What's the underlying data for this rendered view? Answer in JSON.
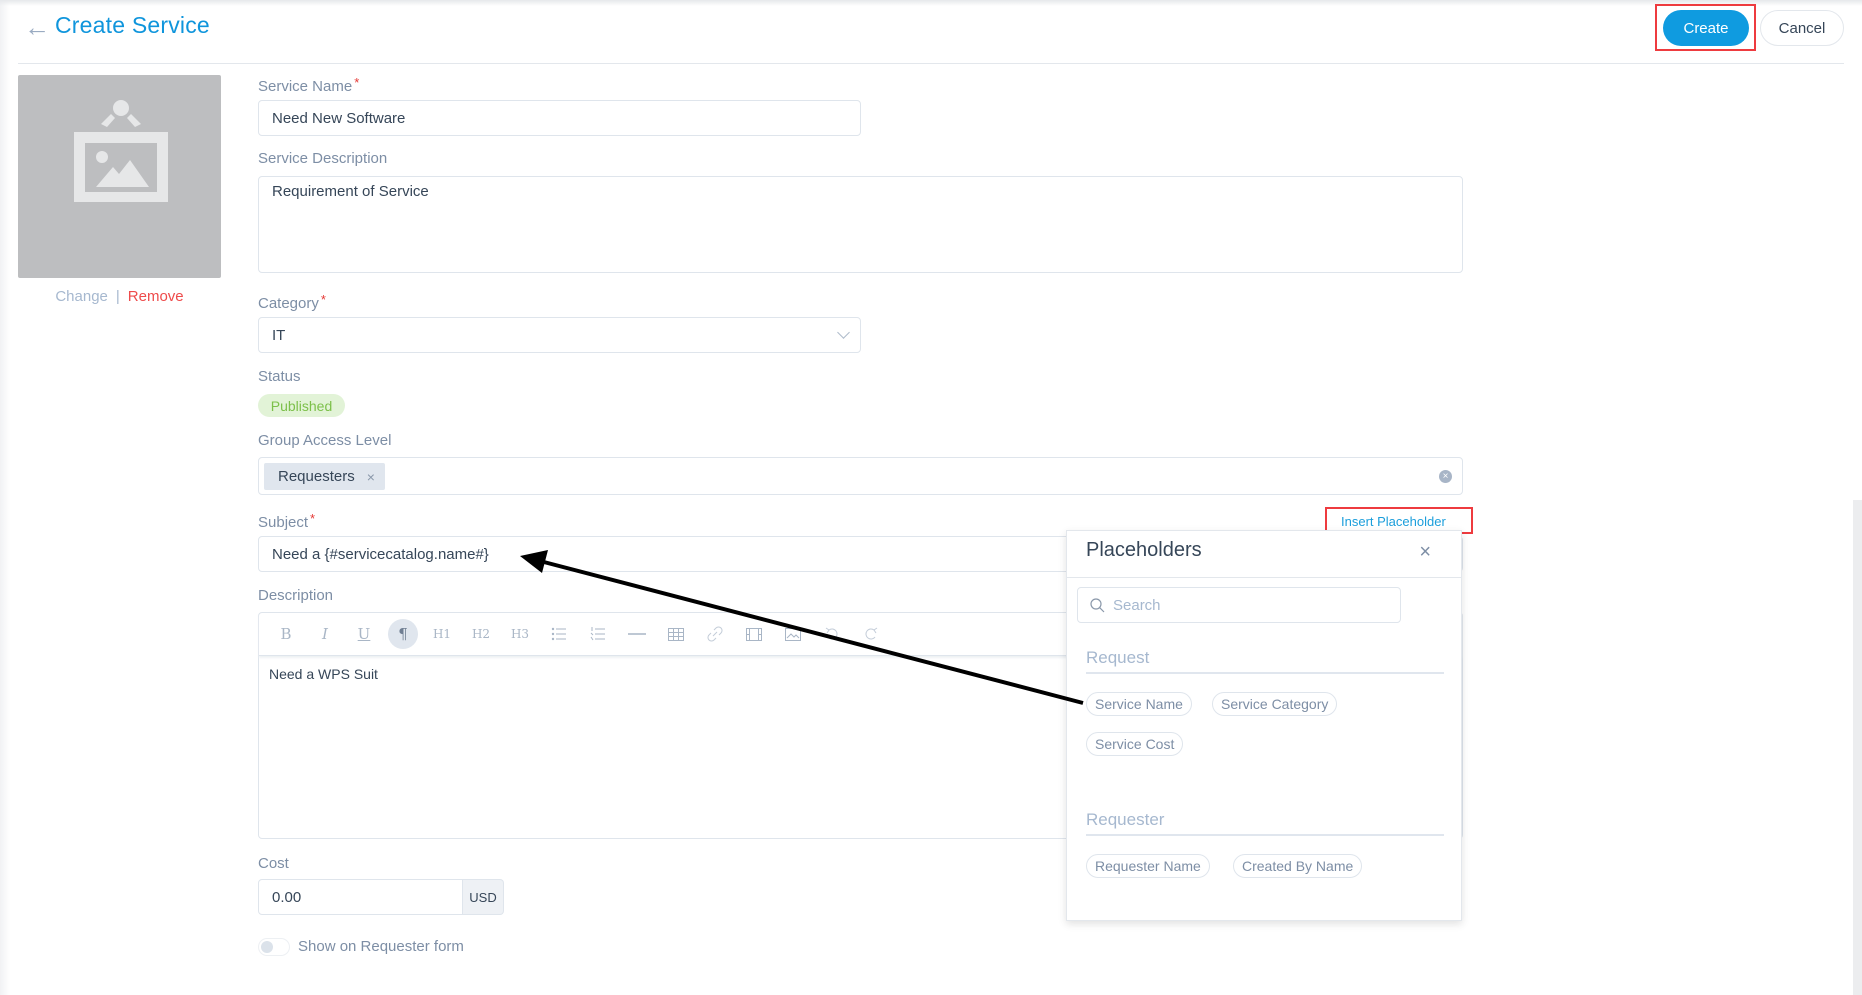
{
  "header": {
    "back_icon": "arrow-left-icon",
    "title": "Create Service",
    "create_label": "Create",
    "cancel_label": "Cancel"
  },
  "image": {
    "placeholder_icon": "image-placeholder-icon",
    "change_label": "Change",
    "separator": "|",
    "remove_label": "Remove"
  },
  "form": {
    "service_name": {
      "label": "Service Name",
      "required": "*",
      "value": "Need New Software"
    },
    "service_description": {
      "label": "Service Description",
      "value": "Requirement of Service"
    },
    "category": {
      "label": "Category",
      "required": "*",
      "value": "IT"
    },
    "status": {
      "label": "Status",
      "value": "Published"
    },
    "group_access": {
      "label": "Group Access Level",
      "tags": [
        "Requesters"
      ],
      "remove_icon": "×"
    },
    "subject": {
      "label": "Subject",
      "required": "*",
      "value": "Need a {#servicecatalog.name#}",
      "insert_placeholder": "Insert Placeholder"
    },
    "description": {
      "label": "Description",
      "toolbar": [
        "B",
        "I",
        "U",
        "¶",
        "H1",
        "H2",
        "H3",
        "bullet-list",
        "ordered-list",
        "horizontal-rule",
        "table",
        "link",
        "video",
        "image",
        "undo",
        "redo"
      ],
      "value": "Need a WPS Suit"
    },
    "cost": {
      "label": "Cost",
      "value": "0.00",
      "currency": "USD"
    },
    "show_on_requester": {
      "label": "Show on Requester form",
      "enabled": false
    }
  },
  "placeholders_popup": {
    "title": "Placeholders",
    "close_icon": "×",
    "search_placeholder": "Search",
    "sections": [
      {
        "title": "Request",
        "items": [
          "Service Name",
          "Service Category",
          "Service Cost"
        ]
      },
      {
        "title": "Requester",
        "items": [
          "Requester Name",
          "Created By Name"
        ]
      }
    ]
  },
  "colors": {
    "accent": "#0f9be0",
    "title": "#0f95dc",
    "danger": "#ee4b4b",
    "highlight_box": "#ee3b3f",
    "published_bg": "#e2f3d7",
    "published_text": "#7cc04a"
  }
}
